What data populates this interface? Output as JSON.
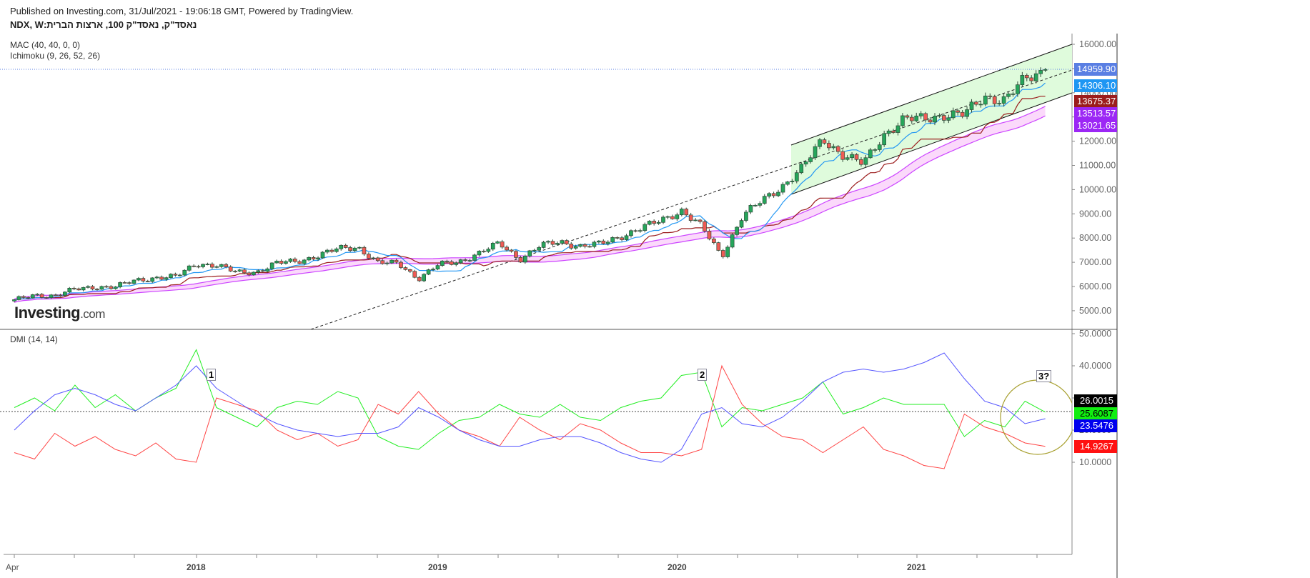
{
  "header": {
    "published": "Published on Investing.com, 31/Jul/2021 - 19:06:18 GMT, Powered by TradingView.",
    "title": "נאסד\"ק, נאסד\"ק 100, ארצות הברית:NDX, W"
  },
  "indicators": {
    "mac": "MAC (40, 40, 0, 0)",
    "ichimoku": "Ichimoku (9, 26, 52, 26)",
    "dmi": "DMI (14, 14)"
  },
  "logo": {
    "main": "Investing",
    ".com": ".com"
  },
  "annotations": [
    "1",
    "2",
    "3?"
  ],
  "colors": {
    "up": "#26a65b",
    "down": "#f05a55",
    "tenkan": "#2196f3",
    "kijun": "#9b1c1c",
    "mac": "#cc44ff",
    "mac_fill": "#fbd9fb",
    "channel_fill": "#dffbdc",
    "plus_di": "#22ee22",
    "minus_di": "#ff4444",
    "adx": "#5555ff"
  },
  "price_labels": [
    {
      "text": "14959.90",
      "color": "#5a7fe3"
    },
    {
      "text": "14306.10",
      "color": "#1e96f3"
    },
    {
      "text": "13675.37",
      "color": "#9b1c1c"
    },
    {
      "text": "13513.57",
      "color": "#9c27f5"
    },
    {
      "text": "13021.65",
      "color": "#9c27f5"
    }
  ],
  "dmi_labels": [
    {
      "text": "26.0015",
      "color": "#000000"
    },
    {
      "text": "25.6087",
      "color": "#11ee11"
    },
    {
      "text": "23.5476",
      "color": "#0000ee"
    },
    {
      "text": "14.9267",
      "color": "#ff1111"
    }
  ],
  "chart_data": [
    {
      "type": "candlestick",
      "title": "NDX, W",
      "timeframe": "weekly",
      "x_range": [
        "Apr 2017",
        "Jul 2021"
      ],
      "months": [
        "2017-04",
        "2017-05",
        "2017-06",
        "2017-07",
        "2017-08",
        "2017-09",
        "2017-10",
        "2017-11",
        "2017-12",
        "2018-01",
        "2018-02",
        "2018-03",
        "2018-04",
        "2018-05",
        "2018-06",
        "2018-07",
        "2018-08",
        "2018-09",
        "2018-10",
        "2018-11",
        "2018-12",
        "2019-01",
        "2019-02",
        "2019-03",
        "2019-04",
        "2019-05",
        "2019-06",
        "2019-07",
        "2019-08",
        "2019-09",
        "2019-10",
        "2019-11",
        "2019-12",
        "2020-01",
        "2020-02",
        "2020-03",
        "2020-04",
        "2020-05",
        "2020-06",
        "2020-07",
        "2020-08",
        "2020-09",
        "2020-10",
        "2020-11",
        "2020-12",
        "2021-01",
        "2021-02",
        "2021-03",
        "2021-04",
        "2021-05",
        "2021-06",
        "2021-07"
      ],
      "monthly_close": [
        5420,
        5650,
        5620,
        5880,
        5990,
        5980,
        6250,
        6370,
        6400,
        6950,
        6870,
        6580,
        6610,
        6970,
        7040,
        7270,
        7550,
        7630,
        6970,
        6950,
        6330,
        6900,
        7030,
        7380,
        7780,
        7130,
        7670,
        7850,
        7660,
        7750,
        8080,
        8400,
        8730,
        9150,
        8460,
        7250,
        8890,
        9550,
        10160,
        10900,
        12110,
        11420,
        11050,
        12270,
        12890,
        12930,
        13090,
        13090,
        13860,
        13690,
        14550,
        14959.9
      ],
      "last_price": 14959.9,
      "tenkan_last": 14306.1,
      "kijun_last": 13675.37,
      "mac_upper_last": 13513.57,
      "mac_lower_last": 13021.65,
      "y_ticks": [
        "16000.00",
        "15000.00",
        "14000.00",
        "13000.00",
        "12000.00",
        "11000.00",
        "10000.00",
        "9000.00",
        "8000.00",
        "7000.00",
        "6000.00",
        "5000.00"
      ],
      "ylim": [
        4250,
        16300
      ],
      "x_ticks": [
        "Apr",
        "2018",
        "2019",
        "2020",
        "2021"
      ]
    },
    {
      "type": "line",
      "title": "DMI (14, 14)",
      "series": [
        {
          "name": "+DI",
          "values": [
            27,
            30,
            26,
            34,
            27,
            31,
            26,
            30,
            33,
            45,
            27,
            24,
            21,
            27,
            29,
            28,
            32,
            30,
            18,
            15,
            14,
            19,
            23,
            24,
            28,
            25,
            24,
            28,
            24,
            23,
            27,
            29,
            30,
            37,
            38,
            21,
            27,
            26,
            28,
            30,
            35,
            25,
            27,
            30,
            28,
            28,
            28,
            18,
            23,
            21,
            29,
            25.6087
          ]
        },
        {
          "name": "-DI",
          "values": [
            13,
            11,
            19,
            15,
            18,
            14,
            12,
            16,
            11,
            10,
            30,
            28,
            26,
            20,
            17,
            19,
            15,
            17,
            28,
            25,
            32,
            25,
            20,
            18,
            15,
            24,
            20,
            17,
            22,
            20,
            16,
            13,
            13,
            12,
            14,
            40,
            28,
            22,
            18,
            17,
            13,
            17,
            21,
            14,
            12,
            9,
            8,
            25,
            21,
            19,
            16,
            14.9267
          ]
        },
        {
          "name": "ADX",
          "values": [
            20,
            26,
            31,
            33,
            31,
            28,
            26,
            30,
            34,
            40,
            33,
            29,
            25,
            22,
            20,
            19,
            18,
            19,
            19,
            21,
            27,
            24,
            20,
            17,
            15,
            15,
            17,
            18,
            18,
            16,
            13,
            11,
            10,
            14,
            25,
            27,
            22,
            21,
            24,
            29,
            35,
            38,
            39,
            38,
            39,
            41,
            44,
            36,
            29,
            27,
            22,
            23.5476
          ]
        }
      ],
      "reference_line": 26.0015,
      "y_ticks": [
        "50.0000",
        "40.0000",
        "30.0000",
        "20.0000",
        "10.0000"
      ],
      "ylim": [
        4,
        51
      ]
    }
  ]
}
